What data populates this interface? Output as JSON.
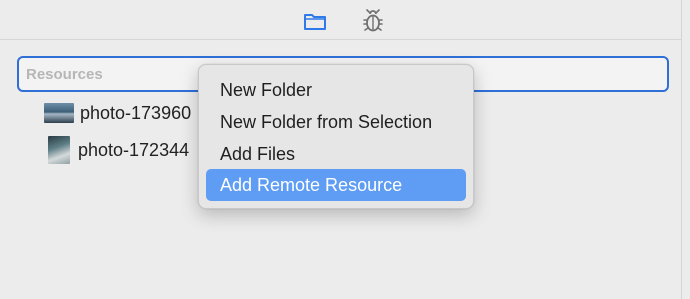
{
  "toolbar": {
    "icons": [
      "folder-icon",
      "bug-icon"
    ],
    "accent": "#2f6fd6"
  },
  "filter": {
    "header": "Resources"
  },
  "resources": [
    {
      "label": "photo-173960",
      "icon": "image-thumbnail"
    },
    {
      "label": "photo-172344",
      "icon": "image-thumbnail"
    }
  ],
  "context_menu": {
    "items": [
      {
        "label": "New Folder"
      },
      {
        "label": "New Folder from Selection"
      },
      {
        "label": "Add Files"
      },
      {
        "label": "Add Remote Resource",
        "highlighted": true
      }
    ],
    "highlight_color": "#5e9df3"
  }
}
